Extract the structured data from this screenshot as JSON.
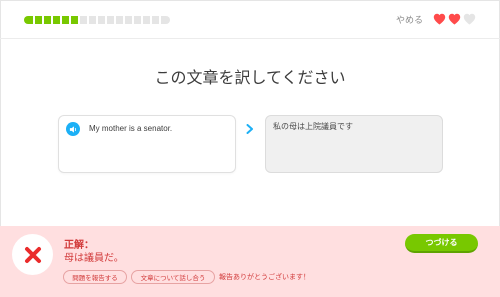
{
  "header": {
    "progress": {
      "completed": 6,
      "total": 16
    },
    "quit_label": "やめる",
    "hearts": {
      "filled": 2,
      "total": 3
    }
  },
  "prompt": {
    "title": "この文章を訳してください"
  },
  "exercise": {
    "source_sentence": "My mother is a senator.",
    "user_answer": "私の母は上院議員です"
  },
  "feedback": {
    "title": "正解：",
    "correct_answer": "母は議員だ。",
    "report_button_label": "問題を報告する",
    "discuss_button_label": "文章について話し合う",
    "report_thanks": "報告ありがとうございます！",
    "continue_label": "つづける"
  },
  "colors": {
    "progress_green": "#78c800",
    "heart_red": "#ff4b4b",
    "heart_empty": "#e5e5e5",
    "speaker_blue": "#1cb0f6",
    "error_bg": "#ffdfe0",
    "error_text": "#d23b3b",
    "continue_green": "#78c800"
  },
  "icons": {
    "speaker": "speaker-icon",
    "chevron": "chevron-right-icon",
    "error": "x-mark-icon",
    "heart": "heart-icon"
  }
}
